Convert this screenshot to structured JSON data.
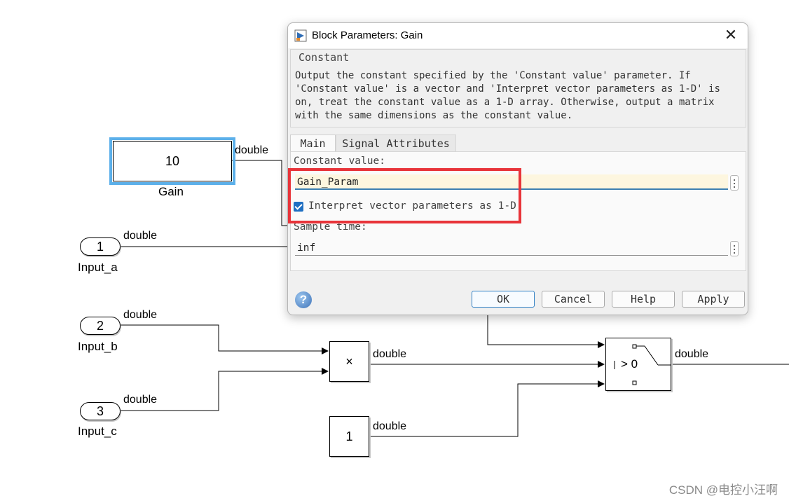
{
  "diagram": {
    "gain_block": {
      "value": "10",
      "name": "Gain",
      "signal": "double"
    },
    "input_a": {
      "port": "1",
      "name": "Input_a",
      "signal": "double"
    },
    "input_b": {
      "port": "2",
      "name": "Input_b",
      "signal": "double"
    },
    "input_c": {
      "port": "3",
      "name": "Input_c",
      "signal": "double"
    },
    "product_block": {
      "symbol": "×",
      "signal": "double"
    },
    "const_block": {
      "value": "1",
      "signal": "double"
    },
    "switch_block": {
      "criteria": "> 0",
      "signal": "double"
    }
  },
  "watermark": "CSDN @电控小汪啊",
  "dialog": {
    "title": "Block Parameters: Gain",
    "group_title": "Constant",
    "description": "Output the constant specified by the 'Constant value' parameter. If 'Constant value' is a vector and 'Interpret vector parameters as 1-D' is on, treat the constant value as a 1-D array. Otherwise, output a matrix with the same dimensions as the constant value.",
    "tabs": [
      {
        "label": "Main"
      },
      {
        "label": "Signal Attributes"
      }
    ],
    "constant_value_label": "Constant value:",
    "constant_value": "Gain_Param",
    "interpret_label": "Interpret vector parameters as 1-D",
    "interpret_checked": true,
    "sample_time_label": "Sample time:",
    "sample_time": "inf",
    "buttons": {
      "ok": "OK",
      "cancel": "Cancel",
      "help": "Help",
      "apply": "Apply"
    },
    "help_glyph": "?"
  },
  "colors": {
    "highlight": "#e8343a",
    "selection": "#5cb0ea",
    "checkbox": "#1f6fc2"
  }
}
